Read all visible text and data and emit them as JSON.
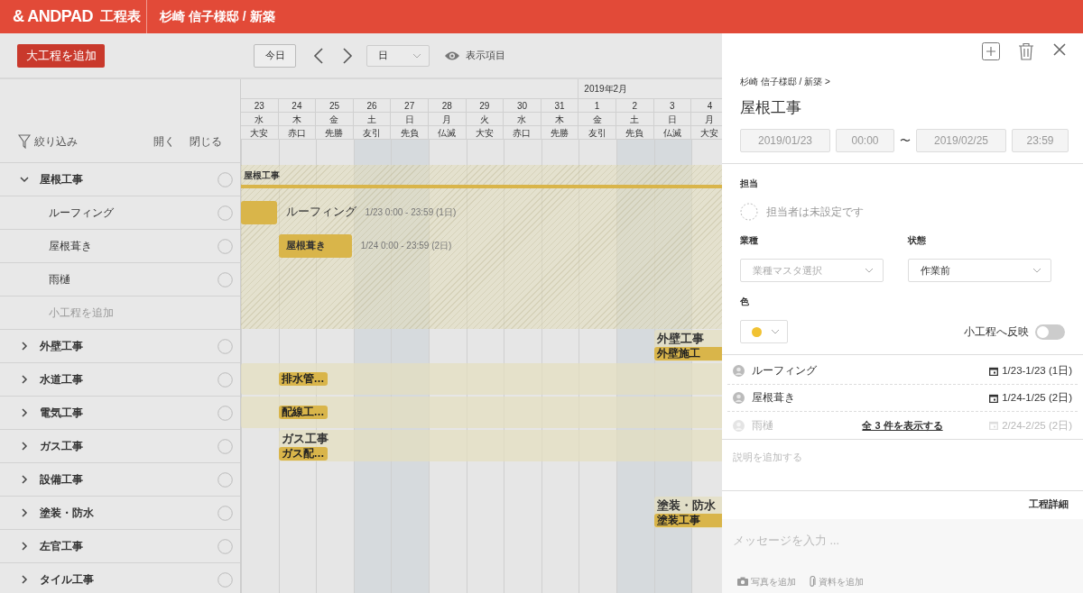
{
  "header": {
    "logo": "& ANDPAD",
    "app_name": "工程表",
    "project": "杉崎 信子様邸 / 新築"
  },
  "toolbar": {
    "add_button": "大工程を追加",
    "today_button": "今日",
    "view_select": "日",
    "display_items": "表示項目"
  },
  "sidebar": {
    "filter": "絞り込み",
    "expand_all": "開く",
    "collapse_all": "閉じる"
  },
  "calendar": {
    "month_labels": [
      {
        "label": "2019年2月"
      }
    ],
    "days": [
      {
        "day": "23",
        "weekday": "水",
        "rokuyo": "大安",
        "weekend": false
      },
      {
        "day": "24",
        "weekday": "木",
        "rokuyo": "赤口",
        "weekend": false
      },
      {
        "day": "25",
        "weekday": "金",
        "rokuyo": "先勝",
        "weekend": false
      },
      {
        "day": "26",
        "weekday": "土",
        "rokuyo": "友引",
        "weekend": true
      },
      {
        "day": "27",
        "weekday": "日",
        "rokuyo": "先負",
        "weekend": true
      },
      {
        "day": "28",
        "weekday": "月",
        "rokuyo": "仏滅",
        "weekend": false
      },
      {
        "day": "29",
        "weekday": "火",
        "rokuyo": "大安",
        "weekend": false
      },
      {
        "day": "30",
        "weekday": "水",
        "rokuyo": "赤口",
        "weekend": false
      },
      {
        "day": "31",
        "weekday": "木",
        "rokuyo": "先勝",
        "weekend": false
      },
      {
        "day": "1",
        "weekday": "金",
        "rokuyo": "友引",
        "weekend": false
      },
      {
        "day": "2",
        "weekday": "土",
        "rokuyo": "先負",
        "weekend": true
      },
      {
        "day": "3",
        "weekday": "日",
        "rokuyo": "仏滅",
        "weekend": true
      },
      {
        "day": "4",
        "weekday": "月",
        "rokuyo": "大安",
        "weekend": false
      }
    ]
  },
  "schedule": {
    "groups": [
      {
        "label": "屋根工事",
        "expanded": true,
        "add_label": "小工程を追加",
        "summary": {
          "label": "屋根工事"
        },
        "children": [
          {
            "label": "ルーフィング",
            "bar": {
              "label_inside": false,
              "label": "ルーフィング",
              "time": "1/23 0:00 - 23:59 (1日)"
            }
          },
          {
            "label": "屋根葺き",
            "bar": {
              "label_inside": true,
              "label": "屋根葺き",
              "time": "1/24 0:00 - 23:59 (2日)"
            }
          },
          {
            "label": "雨樋"
          }
        ]
      },
      {
        "label": "外壁工事",
        "expanded": false,
        "summary": {
          "label": "外壁工事",
          "tasks": [
            {
              "label": "外壁施工"
            }
          ]
        }
      },
      {
        "label": "水道工事",
        "expanded": false,
        "summary": {
          "tasks": [
            {
              "label": "排水管…"
            }
          ]
        }
      },
      {
        "label": "電気工事",
        "expanded": false,
        "summary": {
          "tasks": [
            {
              "label": "配線工…"
            }
          ]
        }
      },
      {
        "label": "ガス工事",
        "expanded": false,
        "summary": {
          "label": "ガス工事",
          "tasks": [
            {
              "label": "ガス配…"
            }
          ]
        }
      },
      {
        "label": "設備工事",
        "expanded": false
      },
      {
        "label": "塗装・防水",
        "expanded": false,
        "summary": {
          "label": "塗装・防水",
          "tasks": [
            {
              "label": "塗装工事"
            }
          ]
        }
      },
      {
        "label": "左官工事",
        "expanded": false
      },
      {
        "label": "タイル工事",
        "expanded": false
      }
    ]
  },
  "panel": {
    "breadcrumb": "杉崎 信子様邸 / 新築 >",
    "title": "屋根工事",
    "start_date": "2019/01/23",
    "start_time": "00:00",
    "range_separator": "〜",
    "end_date": "2019/02/25",
    "end_time": "23:59",
    "assignee_label": "担当",
    "assignee_placeholder": "担当者は未設定です",
    "trade_label": "業種",
    "trade_placeholder": "業種マスタ選択",
    "status_label": "状態",
    "status_value": "作業前",
    "color_label": "色",
    "color": "#f1c232",
    "reflect_label": "小工程へ反映",
    "reflect_on": false,
    "subtasks": [
      {
        "name": "ルーフィング",
        "dates": "1/23-1/23 (1日)",
        "faded": false
      },
      {
        "name": "屋根葺き",
        "dates": "1/24-1/25 (2日)",
        "faded": false
      },
      {
        "name": "雨樋",
        "dates": "2/24-2/25 (2日)",
        "faded": true
      }
    ],
    "show_all": "全 3 件を表示する",
    "description_placeholder": "説明を追加する",
    "details_tab": "工程詳細",
    "message_placeholder": "メッセージを入力 ...",
    "add_photo": "写真を追加",
    "add_file": "資料を追加"
  }
}
